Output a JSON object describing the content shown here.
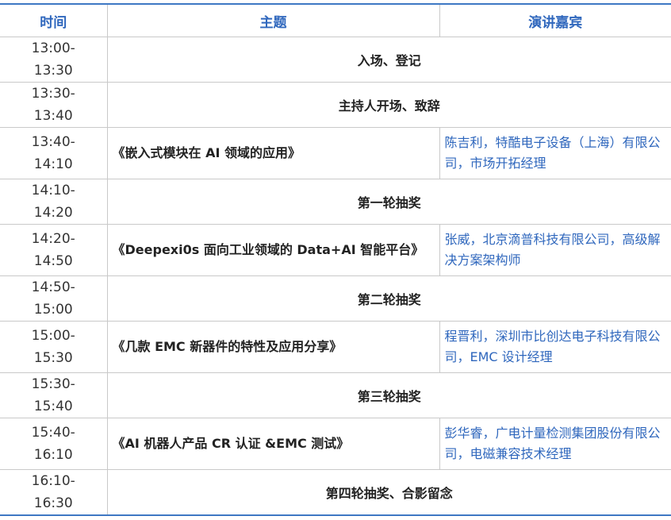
{
  "header": {
    "time": "时间",
    "topic": "主题",
    "speaker": "演讲嘉宾"
  },
  "rows": [
    {
      "start": "13:00-",
      "end": "13:30",
      "topic": "入场、登记"
    },
    {
      "start": "13:30-",
      "end": "13:40",
      "topic": "主持人开场、致辞"
    },
    {
      "start": "13:40-",
      "end": "14:10",
      "topic": "《嵌入式模块在 AI 领域的应用》",
      "speaker": "陈吉利，特酷电子设备（上海）有限公司，市场开拓经理"
    },
    {
      "start": "14:10-",
      "end": "14:20",
      "topic": "第一轮抽奖"
    },
    {
      "start": "14:20-",
      "end": "14:50",
      "topic": "《Deepexi0s 面向工业领域的 Data+AI 智能平台》",
      "speaker": "张威，北京滴普科技有限公司，高级解决方案架构师"
    },
    {
      "start": "14:50-",
      "end": "15:00",
      "topic": "第二轮抽奖"
    },
    {
      "start": "15:00-",
      "end": "15:30",
      "topic": "《几款 EMC 新器件的特性及应用分享》",
      "speaker": "程晋利，深圳市比创达电子科技有限公司，EMC 设计经理"
    },
    {
      "start": "15:30-",
      "end": "15:40",
      "topic": "第三轮抽奖"
    },
    {
      "start": "15:40-",
      "end": "16:10",
      "topic": "《AI 机器人产品 CR 认证 &EMC 测试》",
      "speaker": "彭华睿，广电计量检测集团股份有限公司，电磁兼容技术经理"
    },
    {
      "start": "16:10-",
      "end": "16:30",
      "topic": "第四轮抽奖、合影留念"
    }
  ]
}
